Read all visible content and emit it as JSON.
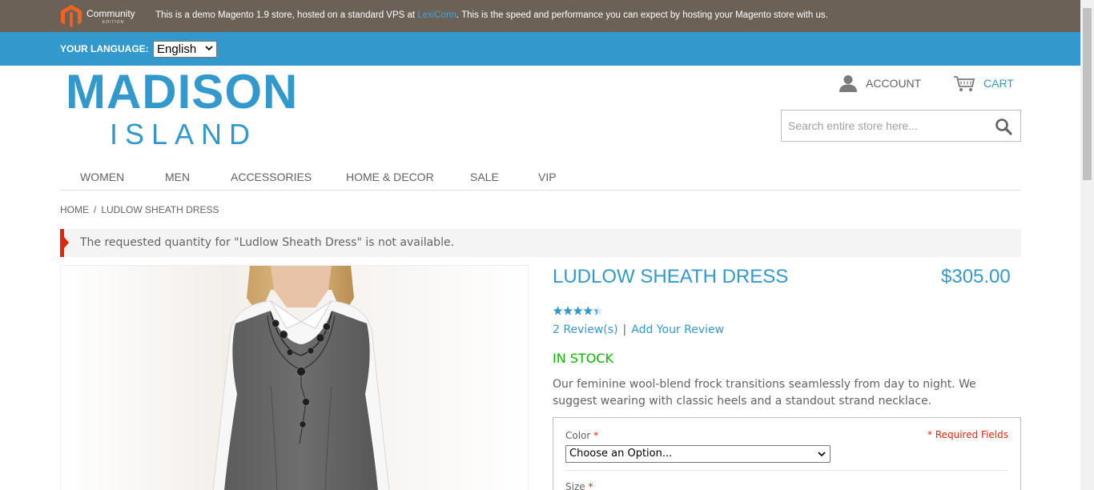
{
  "demo_bar": {
    "logo_text": "Community",
    "logo_edition": "EDITION",
    "message_before": "This is a demo Magento 1.9 store, hosted on a standard VPS at ",
    "message_link": "LexiConn",
    "message_after": ". This is the speed and performance you can expect by hosting your Magento store with us.",
    "colors": {
      "background": "#6b6156",
      "logo_orange": "#f26322",
      "link": "#4aa0d8"
    }
  },
  "language": {
    "label": "YOUR LANGUAGE:",
    "selected": "English"
  },
  "logo": {
    "line1": "MADISON",
    "line2": "ISLAND"
  },
  "header": {
    "account_label": "ACCOUNT",
    "account_icon": "user-icon",
    "cart_label": "CART",
    "cart_icon": "cart-icon",
    "search_placeholder": "Search entire store here...",
    "search_icon": "search-icon"
  },
  "nav": {
    "items": [
      {
        "label": "WOMEN"
      },
      {
        "label": "MEN"
      },
      {
        "label": "ACCESSORIES"
      },
      {
        "label": "HOME & DECOR"
      },
      {
        "label": "SALE"
      },
      {
        "label": "VIP"
      }
    ]
  },
  "breadcrumb": {
    "home": "HOME",
    "separator": "/",
    "current": "LUDLOW SHEATH DRESS"
  },
  "message": {
    "error_text": "The requested quantity for \"Ludlow Sheath Dress\" is not available."
  },
  "product": {
    "name": "LUDLOW SHEATH DRESS",
    "price": "$305.00",
    "rating_fraction": 0.87,
    "reviews_link": "2 Review(s)",
    "separator": "|",
    "add_review_link": "Add Your Review",
    "stock": "IN STOCK",
    "short_description": "Our feminine wool-blend frock transitions seamlessly from day to night. We suggest wearing with classic heels and a standout strand necklace."
  },
  "options": {
    "color_label": "Color",
    "required_star": "*",
    "required_fields": "* Required Fields",
    "color_selected": "Choose an Option...",
    "size_label": "Size"
  },
  "colors": {
    "accent": "#3399cc",
    "error": "#df280a",
    "in_stock": "#11b400",
    "text": "#636363"
  }
}
